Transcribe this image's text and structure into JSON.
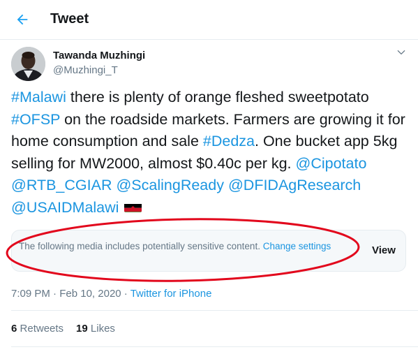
{
  "header": {
    "title": "Tweet",
    "back_icon": "arrow-left-icon",
    "accent": "#1da1f2"
  },
  "author": {
    "name": "Tawanda Muzhingi",
    "handle": "@Muzhingi_T"
  },
  "tweet": {
    "segments": [
      {
        "text": "#Malawi",
        "link": true
      },
      {
        "text": " there is plenty of orange fleshed sweetpotato ",
        "link": false
      },
      {
        "text": "#OFSP",
        "link": true
      },
      {
        "text": " on the roadside markets. Farmers are growing it for home consumption and sale ",
        "link": false
      },
      {
        "text": "#Dedza",
        "link": true
      },
      {
        "text": ". One bucket app 5kg selling for MW2000, almost $0.40c per kg. ",
        "link": false
      },
      {
        "text": "@Cipotato",
        "link": true
      },
      {
        "text": " ",
        "link": false
      },
      {
        "text": "@RTB_CGIAR",
        "link": true
      },
      {
        "text": " ",
        "link": false
      },
      {
        "text": "@ScalingReady",
        "link": true
      },
      {
        "text": " ",
        "link": false
      },
      {
        "text": "@DFIDAgResearch",
        "link": true
      },
      {
        "text": " ",
        "link": false
      },
      {
        "text": "@USAIDMalawi",
        "link": true
      },
      {
        "text": " ",
        "link": false
      }
    ],
    "emoji_icon": "malawi-flag-icon"
  },
  "sensitive": {
    "message": "The following media includes potentially sensitive content.",
    "change_link": "Change settings",
    "view_label": "View"
  },
  "meta": {
    "time": "7:09 PM",
    "separator1": " · ",
    "date": "Feb 10, 2020",
    "separator2": " · ",
    "source": "Twitter for iPhone"
  },
  "stats": {
    "retweets_count": "6",
    "retweets_label": "Retweets",
    "likes_count": "19",
    "likes_label": "Likes"
  },
  "colors": {
    "link": "#1b95e0",
    "muted": "#657786",
    "annotation": "#e2071c"
  }
}
